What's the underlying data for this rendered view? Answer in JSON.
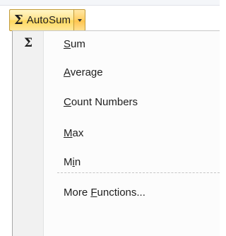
{
  "ribbon": {
    "autosum": {
      "icon": "sigma-icon",
      "icon_glyph": "Σ",
      "label": "AutoSum",
      "dropdown_icon": "chevron-down-icon",
      "highlight_color": "#ffe38a"
    }
  },
  "menu": {
    "items": [
      {
        "icon": "sigma-icon",
        "icon_glyph": "Σ",
        "before": "",
        "key": "S",
        "after": "um"
      },
      {
        "icon": "",
        "icon_glyph": "",
        "before": "",
        "key": "A",
        "after": "verage"
      },
      {
        "icon": "",
        "icon_glyph": "",
        "before": "",
        "key": "C",
        "after": "ount Numbers"
      },
      {
        "icon": "",
        "icon_glyph": "",
        "before": "",
        "key": "M",
        "after": "ax"
      },
      {
        "icon": "",
        "icon_glyph": "",
        "before": "M",
        "key": "i",
        "after": "n"
      },
      {
        "icon": "",
        "icon_glyph": "",
        "before": "More ",
        "key": "F",
        "after": "unctions..."
      }
    ]
  }
}
